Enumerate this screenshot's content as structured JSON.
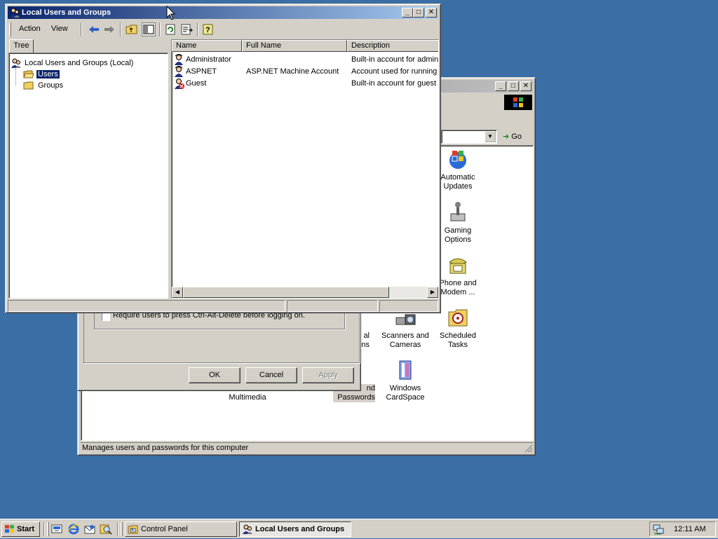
{
  "colors": {
    "desktop": "#3a6ea5",
    "title_active": "#0a246a",
    "selection": "#0a246a"
  },
  "control_panel": {
    "go_label": "Go",
    "status": "Manages users and passwords for this computer",
    "items": [
      {
        "label": "Automatic\nUpdates",
        "icon": "automatic-updates-icon"
      },
      {
        "label": "Gaming\nOptions",
        "icon": "gaming-options-icon"
      },
      {
        "label": "Phone and\nModem ...",
        "icon": "phone-modem-icon"
      },
      {
        "label": "Scanners and\nCameras",
        "icon": "scanners-cameras-icon"
      },
      {
        "label": "Scheduled\nTasks",
        "icon": "scheduled-tasks-icon"
      },
      {
        "label": "Windows\nCardSpace",
        "icon": "cardspace-icon"
      },
      {
        "label": "Multimedia",
        "icon": "multimedia-icon"
      },
      {
        "label": "nd\nPasswords",
        "icon": "users-passwords-icon"
      },
      {
        "label": "al\nns",
        "icon": "partial-icon"
      }
    ]
  },
  "dialog": {
    "checkbox_label": "Require users to press Ctrl-Alt-Delete before logging on.",
    "ok": "OK",
    "cancel": "Cancel",
    "apply": "Apply"
  },
  "lusrmgr": {
    "title": "Local Users and Groups",
    "menu": [
      "Action",
      "View"
    ],
    "tree_tab": "Tree",
    "tree": {
      "root": "Local Users and Groups (Local)",
      "children": [
        "Users",
        "Groups"
      ],
      "selected": "Users"
    },
    "columns": [
      "Name",
      "Full Name",
      "Description"
    ],
    "rows": [
      {
        "name": "Administrator",
        "full_name": "",
        "description": "Built-in account for adminis",
        "icon": "user-icon"
      },
      {
        "name": "ASPNET",
        "full_name": "ASP.NET Machine Account",
        "description": "Account used for running",
        "icon": "user-icon"
      },
      {
        "name": "Guest",
        "full_name": "",
        "description": "Built-in account for guest a",
        "icon": "disabled-user-icon"
      }
    ]
  },
  "taskbar": {
    "start": "Start",
    "tasks": [
      {
        "label": "Control Panel",
        "icon": "control-panel-icon",
        "active": false
      },
      {
        "label": "Local Users and Groups",
        "icon": "users-icon",
        "active": true
      }
    ],
    "clock": "12:11 AM"
  }
}
